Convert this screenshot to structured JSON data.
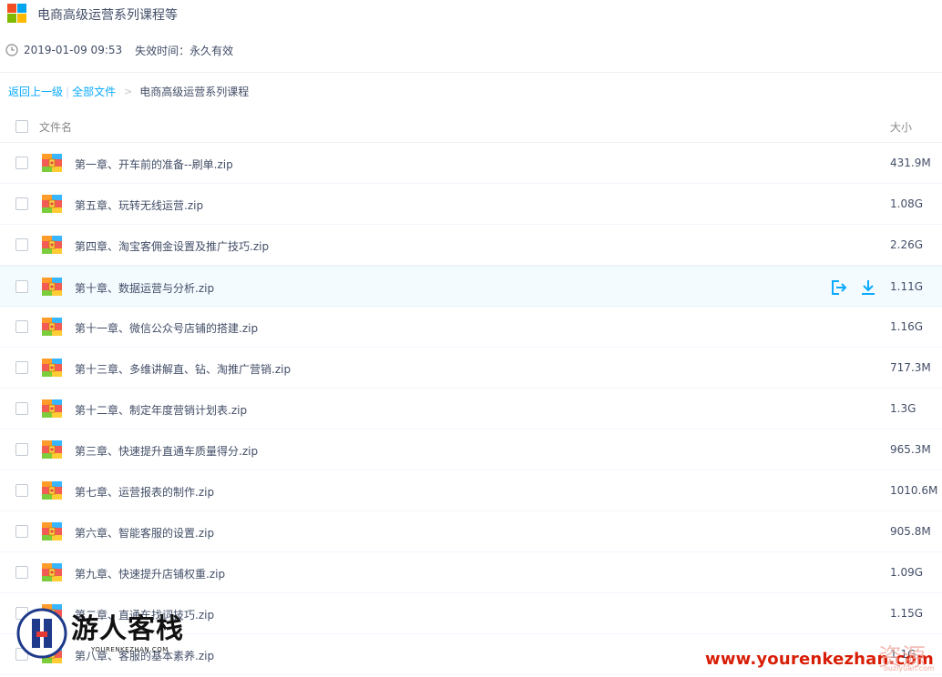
{
  "header": {
    "title": "电商高级运营系列课程等",
    "share_time": "2019-01-09 09:53",
    "expiry": "失效时间：永久有效",
    "logo_colors": [
      "#f25022",
      "#00a4ef",
      "#7fba00",
      "#ffb900"
    ]
  },
  "breadcrumb": {
    "back": "返回上一级",
    "divider": "|",
    "all_files": "全部文件",
    "arrow": ">",
    "current": "电商高级运营系列课程"
  },
  "columns": {
    "name": "文件名",
    "size": "大小"
  },
  "files": [
    {
      "name": "第一章、开车前的准备--刷单.zip",
      "size": "431.9M"
    },
    {
      "name": "第五章、玩转无线运营.zip",
      "size": "1.08G"
    },
    {
      "name": "第四章、淘宝客佣金设置及推广技巧.zip",
      "size": "2.26G"
    },
    {
      "name": "第十章、数据运营与分析.zip",
      "size": "1.11G",
      "hover": true
    },
    {
      "name": "第十一章、微信公众号店铺的搭建.zip",
      "size": "1.16G"
    },
    {
      "name": "第十三章、多维讲解直、钻、淘推广营销.zip",
      "size": "717.3M"
    },
    {
      "name": "第十二章、制定年度营销计划表.zip",
      "size": "1.3G"
    },
    {
      "name": "第三章、快速提升直通车质量得分.zip",
      "size": "965.3M"
    },
    {
      "name": "第七章、运营报表的制作.zip",
      "size": "1010.6M"
    },
    {
      "name": "第六章、智能客服的设置.zip",
      "size": "905.8M"
    },
    {
      "name": "第九章、快速提升店铺权重.zip",
      "size": "1.09G"
    },
    {
      "name": "第二章、直通车找词技巧.zip",
      "size": "1.15G"
    },
    {
      "name": "第八章、客服的基本素养.zip",
      "size": "1.1G"
    }
  ],
  "watermark": {
    "left_cn": "游人客栈",
    "left_en": "YOURENKEZHAN.COM",
    "right_url": "www.yourenkezhan.com",
    "right_cn": "资源",
    "right_small": "ouziyuan.com"
  },
  "colors": {
    "link": "#09aaff",
    "action_icon": "#09aaff",
    "text": "#424e67",
    "hover_row": "#f4fbff"
  }
}
